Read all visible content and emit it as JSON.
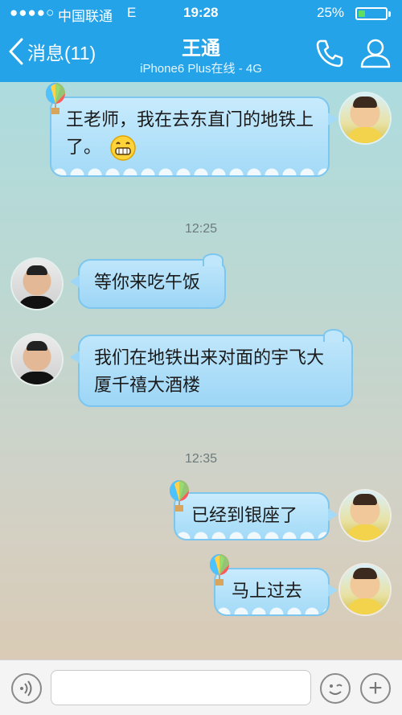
{
  "status_bar": {
    "signal": "●●●●○",
    "carrier": "中国联通",
    "network": "E",
    "time": "19:28",
    "battery": "25%",
    "battery_level": 0.25,
    "battery_color": "#5ee05e"
  },
  "nav": {
    "back_label": "消息(11)",
    "title": "王通",
    "subtitle": "iPhone6 Plus在线 - 4G",
    "bar_color": "#24a3e8",
    "call_icon": "phone-icon",
    "profile_icon": "person-icon"
  },
  "messages": [
    {
      "side": "right",
      "text": "王老师，我在去东直门的地铁上了。",
      "emoji": "grin-emoji"
    },
    {
      "timestamp": "12:25"
    },
    {
      "side": "left",
      "text": "等你来吃午饭"
    },
    {
      "side": "left",
      "text": "我们在地铁出来对面的宇飞大厦千禧大酒楼"
    },
    {
      "timestamp": "12:35"
    },
    {
      "side": "right",
      "text": "已经到银座了"
    },
    {
      "side": "right",
      "text": "马上过去"
    }
  ],
  "input_bar": {
    "placeholder": "",
    "voice_icon": "voice-icon",
    "emoji_icon": "smiley-icon",
    "plus_icon": "plus-icon"
  }
}
